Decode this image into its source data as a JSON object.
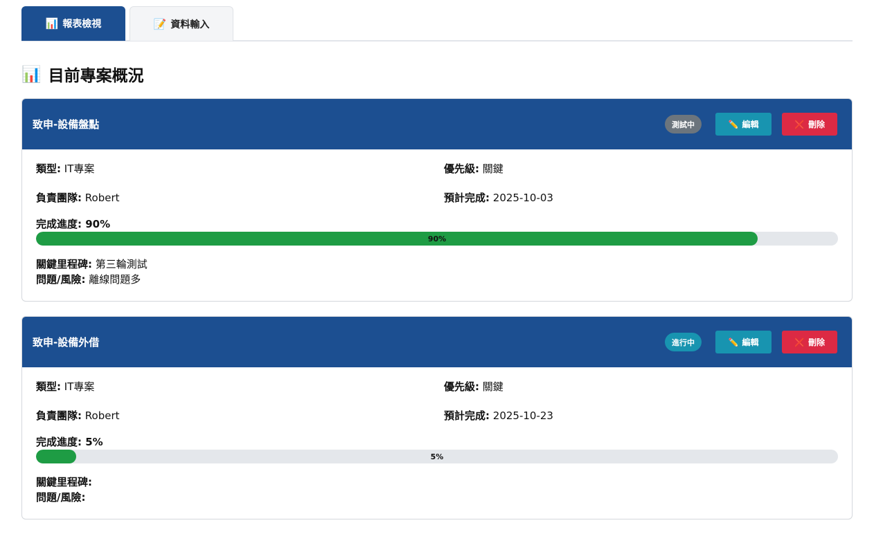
{
  "tabs": [
    {
      "icon": "📊",
      "label": "報表檢視",
      "active": true
    },
    {
      "icon": "📝",
      "label": "資料輸入",
      "active": false
    }
  ],
  "section": {
    "icon": "📊",
    "title": "目前專案概況"
  },
  "labels": {
    "type": "類型:",
    "priority": "優先級:",
    "team": "負責團隊:",
    "due": "預計完成:",
    "progress": "完成進度:",
    "milestone": "關鍵里程碑:",
    "risk": "問題/風險:",
    "edit": "編輯",
    "delete": "刪除"
  },
  "projects": [
    {
      "name": "致申-設備盤點",
      "status": "測試中",
      "status_color": "#6c757d",
      "type": "IT專案",
      "priority": "關鍵",
      "team": "Robert",
      "due": "2025-10-03",
      "progress": 90,
      "progress_label": "90%",
      "milestone": "第三輪測試",
      "risk": "離線問題多"
    },
    {
      "name": "致申-設備外借",
      "status": "進行中",
      "status_color": "#1894b0",
      "type": "IT專案",
      "priority": "關鍵",
      "team": "Robert",
      "due": "2025-10-23",
      "progress": 5,
      "progress_label": "5%",
      "milestone": "",
      "risk": ""
    }
  ],
  "colors": {
    "primary": "#1c4f91",
    "edit": "#1894b0",
    "delete": "#dc2a44",
    "progress": "#1e9c44"
  }
}
